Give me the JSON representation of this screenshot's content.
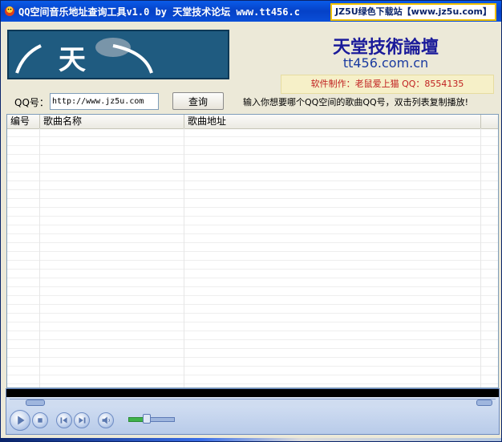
{
  "window": {
    "title": "QQ空间音乐地址查询工具v1.0 by 天堂技术论坛 www.tt456.c",
    "badge": "JZ5U绿色下载站【www.jz5u.com】"
  },
  "banner": {
    "text": "天"
  },
  "site": {
    "title": "天堂技術論壇",
    "url": "tt456.com.cn",
    "credit": "软件制作：老鼠爱上猫  QQ：8554135"
  },
  "form": {
    "qq_label": "QQ号：",
    "qq_value": "http://www.jz5u.com",
    "query_label": "查询",
    "hint": "输入你想要哪个QQ空间的歌曲QQ号，双击列表复制播放!"
  },
  "list": {
    "columns": [
      "编号",
      "歌曲名称",
      "歌曲地址"
    ],
    "rows": []
  },
  "player": {
    "volume_level": 0.4
  },
  "colors": {
    "titlebar": "#0a4fd8",
    "banner": "#1f5b80",
    "credit_text": "#c02020"
  }
}
